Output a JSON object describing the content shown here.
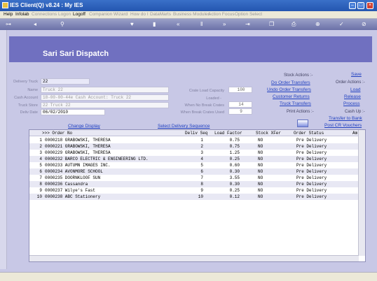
{
  "window": {
    "title": "IES Client(Q) v8.24 : My IES"
  },
  "menu": [
    {
      "label": "Help",
      "disabled": false
    },
    {
      "label": "Infolab",
      "disabled": false
    },
    {
      "label": "Connections",
      "disabled": true
    },
    {
      "label": "Logon",
      "disabled": true
    },
    {
      "label": "Logoff",
      "disabled": false
    },
    {
      "label": "Companion",
      "disabled": true
    },
    {
      "label": "Wizard",
      "disabled": true
    },
    {
      "label": "How do I",
      "disabled": true
    },
    {
      "label": "DataMarts",
      "disabled": true
    },
    {
      "label": "Business Modules",
      "disabled": true
    },
    {
      "label": "Action Focus",
      "disabled": true
    },
    {
      "label": "Option Select",
      "disabled": true
    }
  ],
  "toolbar_icons": [
    "key-icon",
    "back-icon",
    "search-icon",
    "heart-icon",
    "bookmark-icon",
    "rewind-icon",
    "pause-icon",
    "fast-forward-icon",
    "exit-icon",
    "copy-icon",
    "print-icon",
    "plus-icon",
    "check-icon",
    "cancel-icon"
  ],
  "page": {
    "title": "Sari Sari Dispatch"
  },
  "form": {
    "delivery_truck": {
      "label": "Delivery Truck",
      "value": "22"
    },
    "name": {
      "label": "Name",
      "value": "Truck 22"
    },
    "cash_account": {
      "label": "Cash Account",
      "value": "18-00-00-44e Cash Account: Truck 22"
    },
    "truck_store": {
      "label": "Truck Store",
      "value": "22 Truck 22"
    },
    "deliv_date": {
      "label": "Deliv Date",
      "value": "06/02/2010"
    },
    "crate_load_capacity": {
      "label": "Crate Load Capacity",
      "value": "100"
    },
    "loaded": {
      "label": "Loaded -"
    },
    "when_no_break_crates": {
      "label": "When No Break Crates",
      "value": "14"
    },
    "when_break_crates_used": {
      "label": "When Break Crates Used",
      "value": "9"
    }
  },
  "stock_actions": {
    "heading": "Stock Actions :-",
    "items": [
      "Do Order Transfers",
      "Undo Order Transfers",
      "Customer Returns",
      "Truck Transfers"
    ]
  },
  "order_actions": {
    "save": "Save",
    "heading": "Order Actions :-",
    "items": [
      "Load",
      "Release",
      "Process"
    ]
  },
  "print_actions": {
    "heading": "Print Actions :-"
  },
  "cash_up": {
    "heading": "Cash Up :-",
    "items": [
      "Transfer to Bank",
      "Post CR Vouchers"
    ]
  },
  "links": {
    "change_display": "Change Display",
    "select_sequence": "Select Delivery Sequence"
  },
  "grid": {
    "columns": [
      ">>> Order No",
      "Deliv Seq",
      "Load Factor",
      "Stock XFer",
      "Order Status",
      "Am"
    ],
    "rows": [
      {
        "n": "1",
        "order": "0000218 GRABOWSKI, THERESA",
        "seq": "1",
        "load": "0.75",
        "xfer": "NO",
        "status": "Pre Delivery"
      },
      {
        "n": "2",
        "order": "0000221 GRABOWSKI, THERESA",
        "seq": "2",
        "load": "0.75",
        "xfer": "NO",
        "status": "Pre Delivery"
      },
      {
        "n": "3",
        "order": "0000229 GRABOWSKI, THERESA",
        "seq": "3",
        "load": "1.25",
        "xfer": "NO",
        "status": "Pre Delivery"
      },
      {
        "n": "4",
        "order": "0000232 BARCO ELECTRIC & ENGINEERING LTD.",
        "seq": "4",
        "load": "0.25",
        "xfer": "NO",
        "status": "Pre Delivery"
      },
      {
        "n": "5",
        "order": "0000233 AUTUMN IMAGES INC.",
        "seq": "5",
        "load": "0.60",
        "xfer": "NO",
        "status": "Pre Delivery"
      },
      {
        "n": "6",
        "order": "0000234 AVONMORE SCHOOL",
        "seq": "6",
        "load": "0.30",
        "xfer": "NO",
        "status": "Pre Delivery"
      },
      {
        "n": "7",
        "order": "0000235 DOORNKLOOF SUN",
        "seq": "7",
        "load": "3.55",
        "xfer": "NO",
        "status": "Pre Delivery"
      },
      {
        "n": "8",
        "order": "0000236 Cassandra",
        "seq": "8",
        "load": "0.30",
        "xfer": "NO",
        "status": "Pre Delivery"
      },
      {
        "n": "9",
        "order": "0000237 Wilye's Fast",
        "seq": "9",
        "load": "0.25",
        "xfer": "NO",
        "status": "Pre Delivery"
      },
      {
        "n": "10",
        "order": "0000238 ABC Stationery",
        "seq": "10",
        "load": "0.12",
        "xfer": "NO",
        "status": "Pre Delivery"
      }
    ]
  }
}
